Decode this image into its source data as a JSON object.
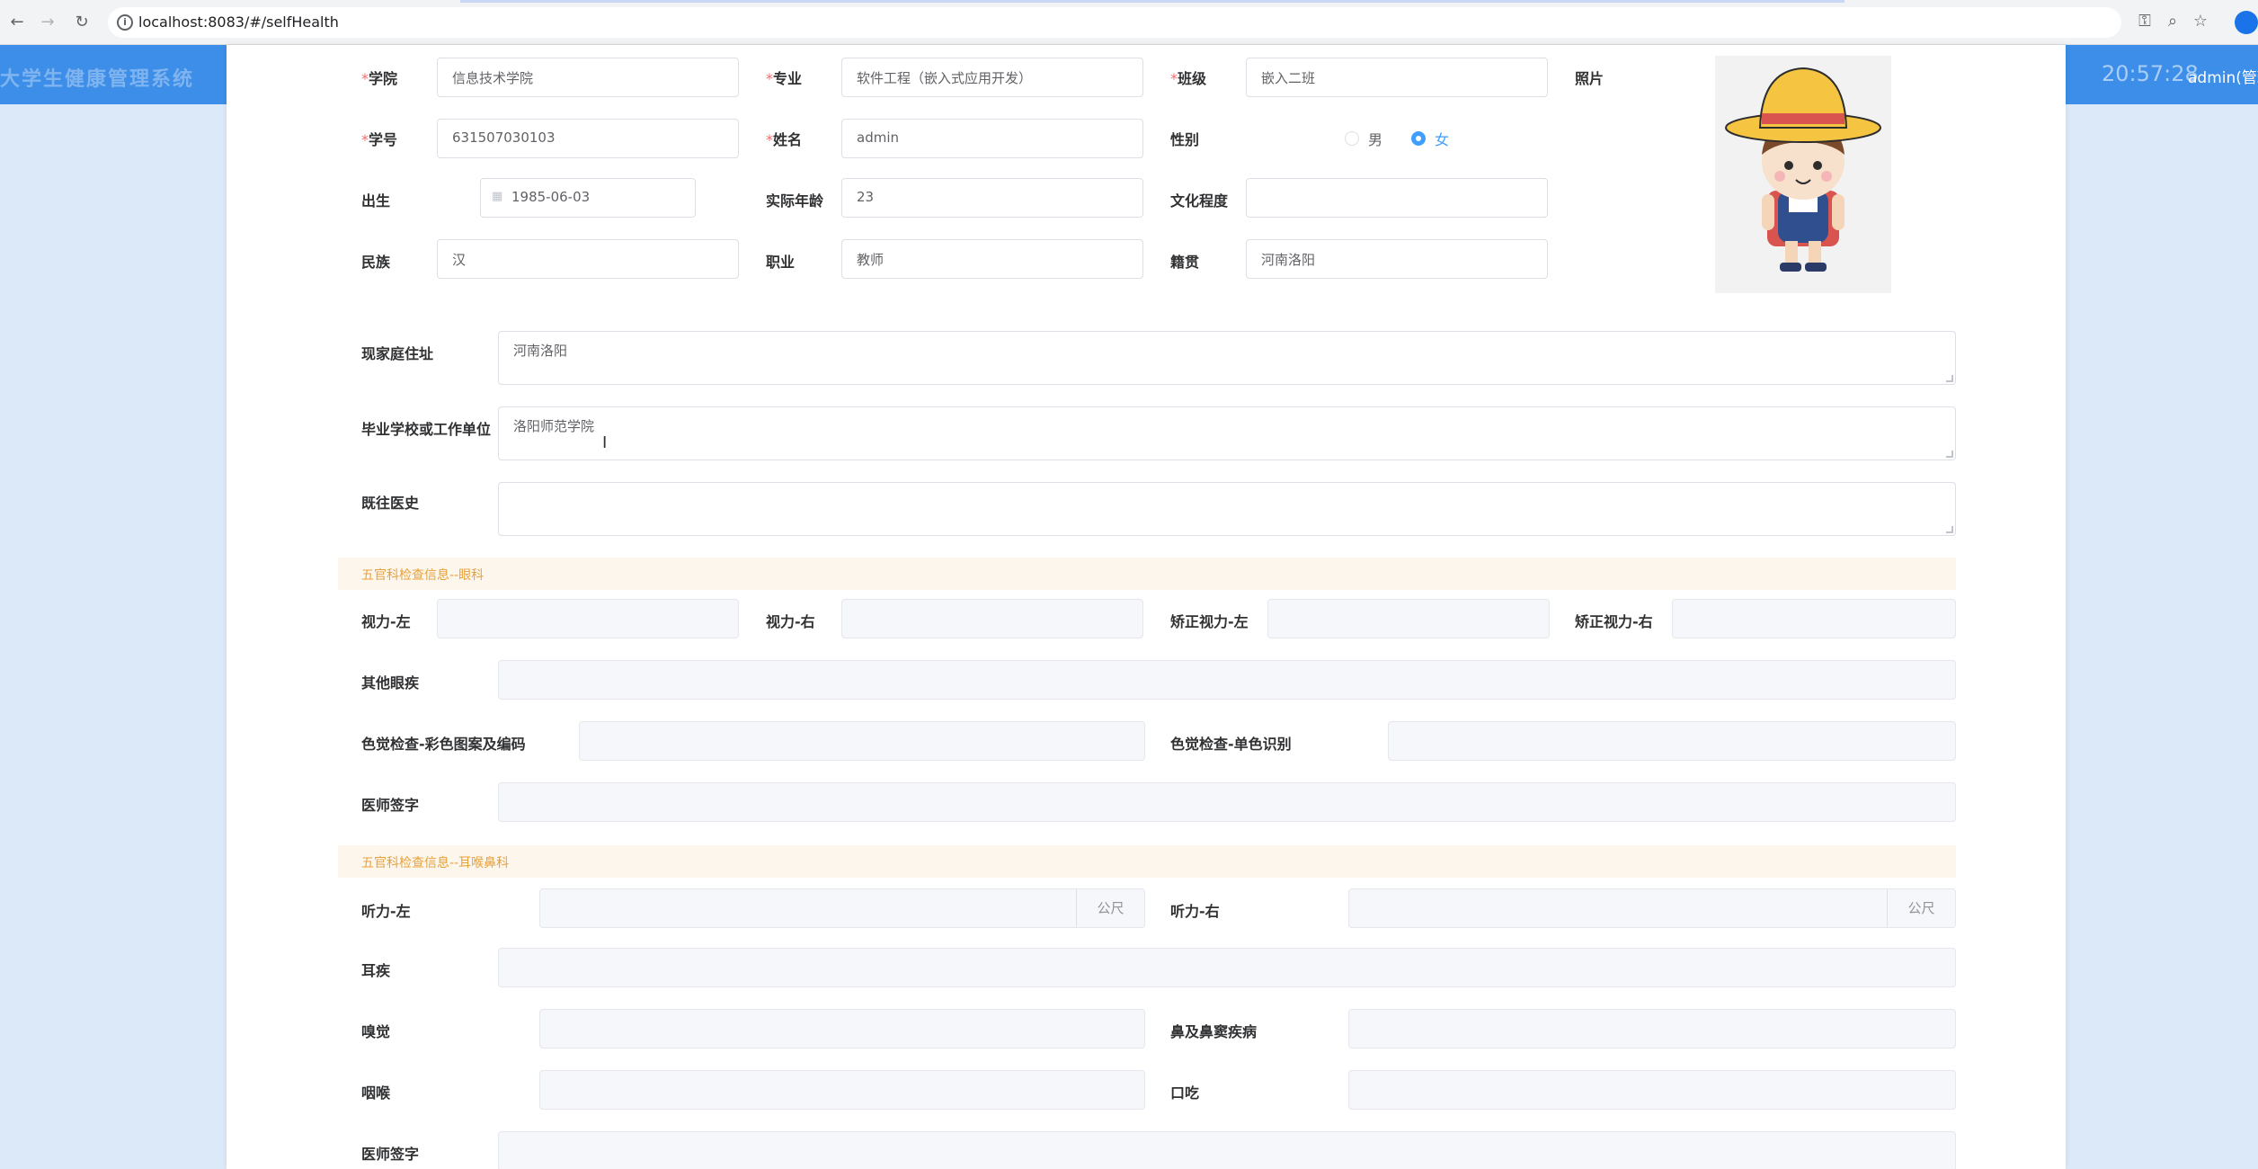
{
  "browser": {
    "url": "localhost:8083/#/selfHealth"
  },
  "app": {
    "title": "大学生健康管理系统",
    "clock": "20:57:28",
    "user": "admin(管理"
  },
  "form": {
    "college": {
      "label": "学院",
      "value": "信息技术学院"
    },
    "major": {
      "label": "专业",
      "value": "软件工程（嵌入式应用开发）"
    },
    "class": {
      "label": "班级",
      "value": "嵌入二班"
    },
    "photo": {
      "label": "照片"
    },
    "student_id": {
      "label": "学号",
      "value": "631507030103"
    },
    "name": {
      "label": "姓名",
      "value": "admin"
    },
    "gender": {
      "label": "性别",
      "options": [
        "男",
        "女"
      ],
      "selected": "女"
    },
    "birth": {
      "label": "出生",
      "value": "1985-06-03"
    },
    "age": {
      "label": "实际年龄",
      "value": "23"
    },
    "education": {
      "label": "文化程度",
      "value": ""
    },
    "ethnicity": {
      "label": "民族",
      "value": "汉"
    },
    "occupation": {
      "label": "职业",
      "value": "教师"
    },
    "native_place": {
      "label": "籍贯",
      "value": "河南洛阳"
    },
    "address": {
      "label": "现家庭住址",
      "value": "河南洛阳"
    },
    "school_work": {
      "label": "毕业学校或工作单位",
      "value": "洛阳师范学院"
    },
    "medical_history": {
      "label": "既往医史",
      "value": ""
    }
  },
  "eye_section": {
    "title": "五官科检查信息--眼科",
    "vision_left": "视力-左",
    "vision_right": "视力-右",
    "corrected_left": "矫正视力-左",
    "corrected_right": "矫正视力-右",
    "other_eye": "其他眼疾",
    "color_pattern": "色觉检查-彩色图案及编码",
    "color_single": "色觉检查-单色识别",
    "doctor_sign": "医师签字"
  },
  "ent_section": {
    "title": "五官科检查信息--耳喉鼻科",
    "hearing_left": "听力-左",
    "hearing_right": "听力-右",
    "unit": "公尺",
    "ear_disease": "耳疾",
    "smell": "嗅觉",
    "nose_disease": "鼻及鼻窦疾病",
    "throat": "咽喉",
    "stutter": "口吃",
    "doctor_sign": "医师签字"
  },
  "colors": {
    "header_blue": "#3d8ee8",
    "section_bg": "#fdf6ec",
    "section_text": "#e6a23c",
    "radio_active": "#409eff"
  }
}
